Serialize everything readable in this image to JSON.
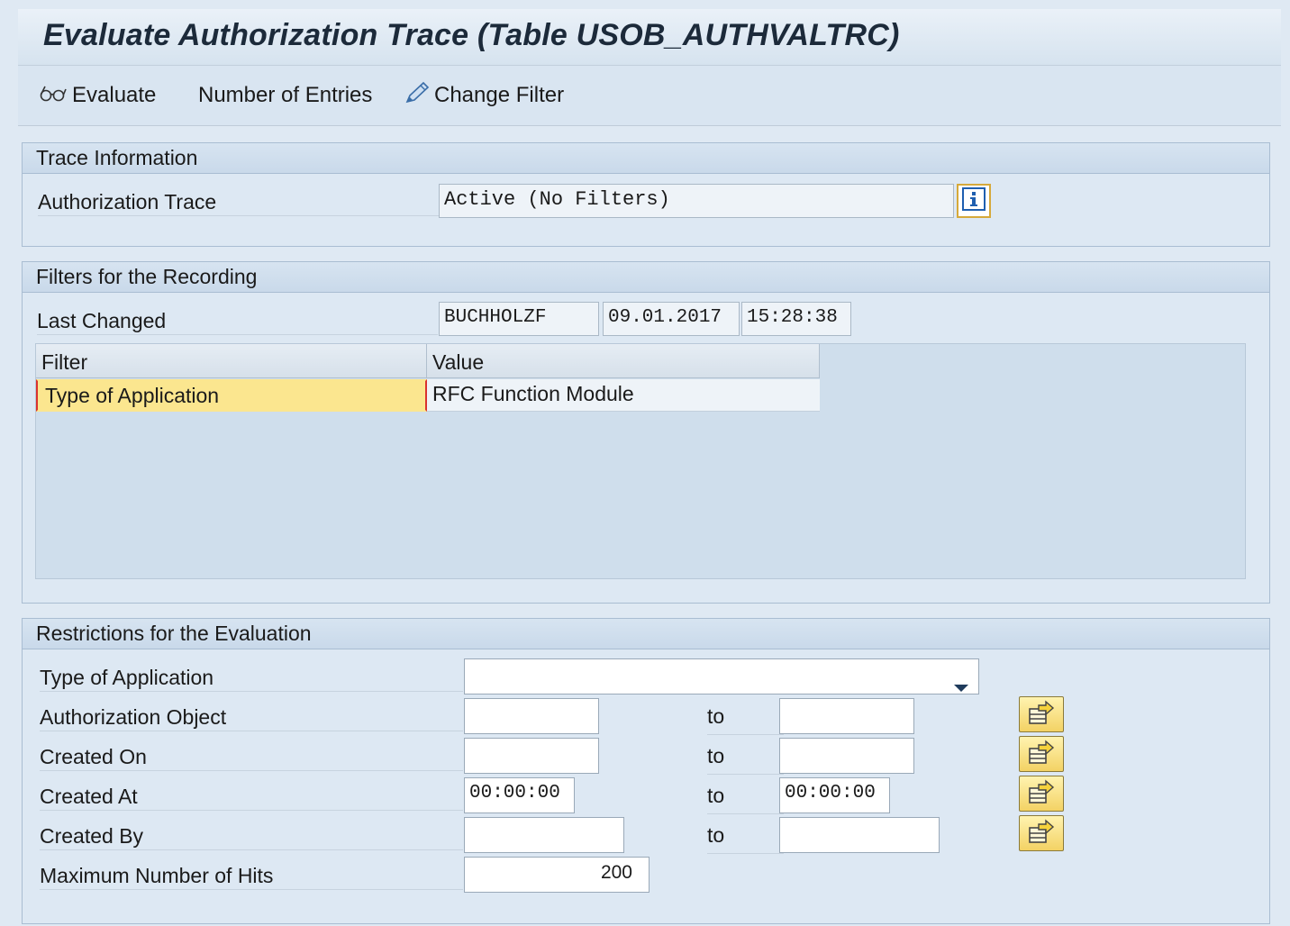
{
  "title": "Evaluate Authorization Trace (Table USOB_AUTHVALTRC)",
  "toolbar": {
    "evaluate": "Evaluate",
    "entries": "Number of Entries",
    "change_filter": "Change Filter"
  },
  "trace_info": {
    "header": "Trace Information",
    "auth_trace_label": "Authorization Trace",
    "auth_trace_value": "Active (No Filters)"
  },
  "filters": {
    "header": "Filters for the Recording",
    "last_changed_label": "Last Changed",
    "changed_by": "BUCHHOLZF",
    "changed_date": "09.01.2017",
    "changed_time": "15:28:38",
    "columns": [
      "Filter",
      "Value"
    ],
    "rows": [
      {
        "filter": "Type of Application",
        "value": "RFC Function Module"
      }
    ]
  },
  "restrictions": {
    "header": "Restrictions for the Evaluation",
    "to_label": "to",
    "type_of_application": {
      "label": "Type of Application",
      "value": ""
    },
    "authorization_object": {
      "label": "Authorization Object",
      "from": "",
      "to": ""
    },
    "created_on": {
      "label": "Created On",
      "from": "",
      "to": ""
    },
    "created_at": {
      "label": "Created At",
      "from": "00:00:00",
      "to": "00:00:00"
    },
    "created_by": {
      "label": "Created By",
      "from": "",
      "to": ""
    },
    "max_hits": {
      "label": "Maximum Number of Hits",
      "value": "200"
    }
  },
  "icons": {
    "evaluate": "glasses-icon",
    "change_filter": "pencil-icon",
    "info": "info-icon",
    "multiple_selection": "multiple-selection-icon",
    "dropdown": "dropdown-arrow-icon"
  },
  "colors": {
    "selected_cell": "#fbe68f",
    "selection_marker": "#d9322f",
    "info_icon": "#1f5fb0"
  }
}
